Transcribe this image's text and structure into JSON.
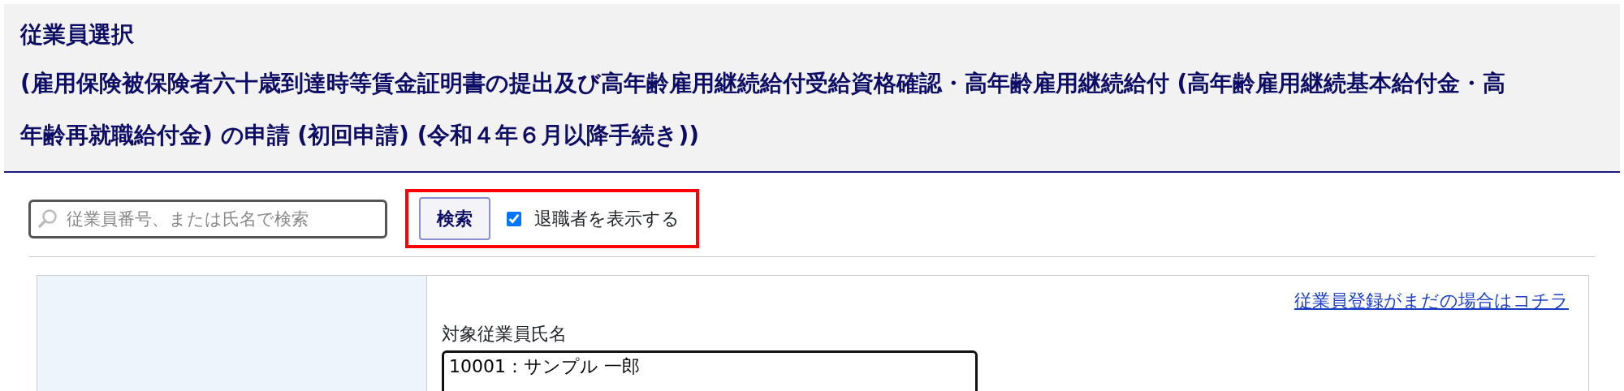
{
  "header": {
    "title": "従業員選択",
    "subtitle": "(雇用保険被保険者六十歳到達時等賃金証明書の提出及び高年齢雇用継続給付受給資格確認・高年齢雇用継続給付 (高年齢雇用継続基本給付金・高年齢再就職給付金) の申請 (初回申請) (令和４年６月以降手続き))"
  },
  "search": {
    "placeholder": "従業員番号、または氏名で検索",
    "button": "検索",
    "highlighted": true,
    "show_retired": {
      "label": "退職者を表示する",
      "checked": true
    }
  },
  "form": {
    "register_link": "従業員登録がまだの場合はコチラ",
    "employee_label": "対象従業員氏名",
    "employee_options": [
      {
        "label": "10001：サンプル 一郎",
        "selected": false
      }
    ]
  }
}
